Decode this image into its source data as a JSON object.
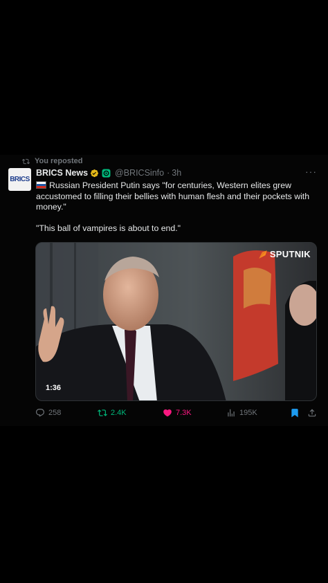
{
  "repost_banner": {
    "icon": "repost-icon",
    "text": "You reposted"
  },
  "author": {
    "avatar_text": "BRICS",
    "name": "BRICS News",
    "handle": "@BRICSinfo",
    "separator": "·",
    "time": "3h",
    "verified_color": "#e2b719",
    "affiliate_color": "#00ba7c"
  },
  "more_label": "···",
  "post": {
    "flag": "russia-flag-icon",
    "paragraph1": "Russian President Putin says \"for centuries, Western elites grew accustomed to filling their bellies with human flesh and their pockets with money.\"",
    "paragraph2": "\"This ball of vampires is about to end.\""
  },
  "media": {
    "duration": "1:36",
    "watermark": "SPUTNIK"
  },
  "actions": {
    "replies": "258",
    "reposts": "2.4K",
    "likes": "7.3K",
    "views": "195K"
  },
  "colors": {
    "background": "#000000",
    "text": "#e7e9ea",
    "muted": "#71767b",
    "repost_active": "#00ba7c",
    "like_active": "#f91880",
    "bookmark_active": "#1d9bf0"
  }
}
